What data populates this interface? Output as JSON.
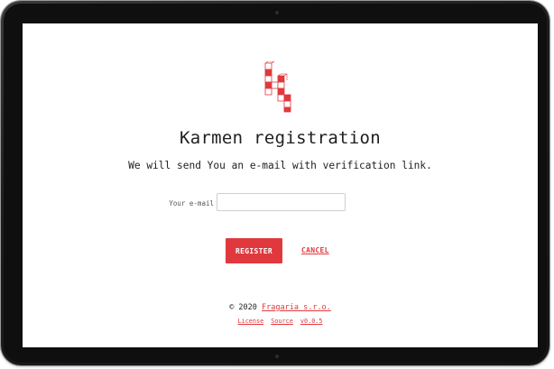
{
  "app": {
    "title": "Karmen registration",
    "subtitle": "We will send You an e-mail with verification link.",
    "logo_icon": "karmen-logo-icon",
    "accent_color": "#e0393d"
  },
  "form": {
    "email_label": "Your e-mail",
    "email_value": "",
    "email_placeholder": "",
    "register_label": "REGISTER",
    "cancel_label": "CANCEL"
  },
  "footer": {
    "copyright": "© 2020",
    "company_link": "Fragaria s.r.o.",
    "license_link": "License",
    "source_link": "Source",
    "version_link": "v0.0.5"
  }
}
